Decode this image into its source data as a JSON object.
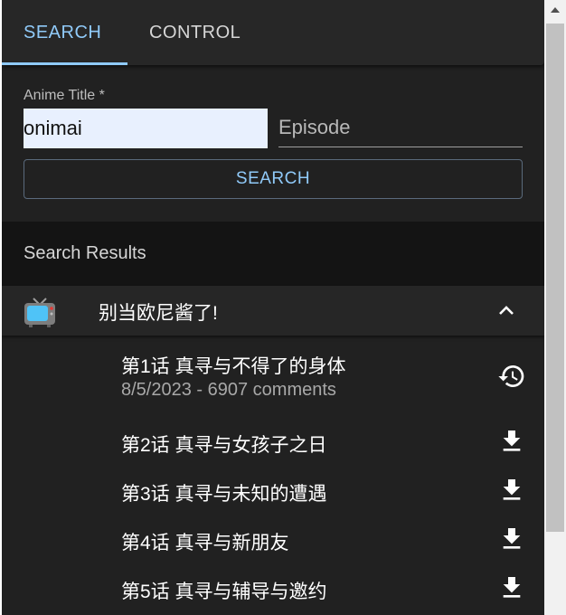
{
  "tabs": {
    "search_label": "SEARCH",
    "control_label": "CONTROL"
  },
  "form": {
    "anime_title_label": "Anime Title *",
    "anime_title_value": "onimai",
    "episode_placeholder": "Episode",
    "search_button_label": "SEARCH"
  },
  "results": {
    "header": "Search Results",
    "anime": {
      "title": "别当欧尼酱了!",
      "icon": "tv-icon",
      "expanded": true
    },
    "episodes": [
      {
        "title": "第1话 真寻与不得了的身体",
        "meta": "8/5/2023 - 6907 comments",
        "action_icon": "history-icon"
      },
      {
        "title": "第2话 真寻与女孩子之日",
        "action_icon": "download-icon"
      },
      {
        "title": "第3话 真寻与未知的遭遇",
        "action_icon": "download-icon"
      },
      {
        "title": "第4话 真寻与新朋友",
        "action_icon": "download-icon"
      },
      {
        "title": "第5话 真寻与辅导与邀约",
        "action_icon": "download-icon"
      }
    ]
  },
  "colors": {
    "accent": "#90caf9",
    "background": "#212121",
    "input_autofill": "#e8f0fe"
  }
}
